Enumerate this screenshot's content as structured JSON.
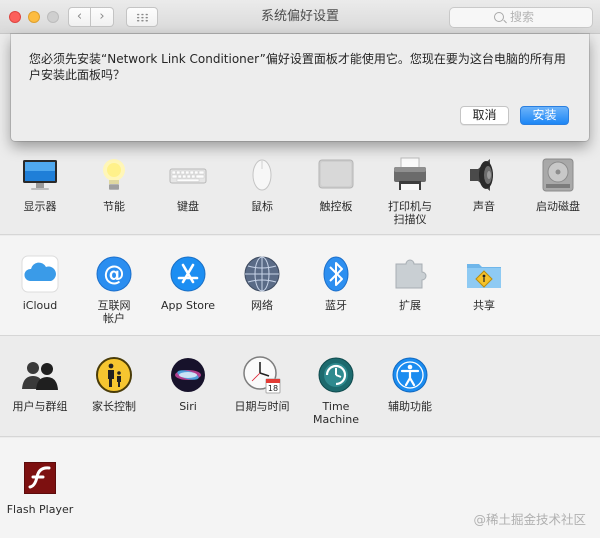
{
  "window": {
    "title": "系统偏好设置",
    "search_placeholder": "搜索",
    "back_glyph": "‹",
    "forward_glyph": "›"
  },
  "dialog": {
    "message": "您必须先安装“Network Link Conditioner”偏好设置面板才能使用它。您现在要为这台电脑的所有用户安装此面板吗？",
    "cancel_label": "取消",
    "install_label": "安装",
    "accent_color": "#1d86f5"
  },
  "rows": [
    {
      "items": [
        {
          "label": "显示器",
          "icon": "display-icon"
        },
        {
          "label": "节能",
          "icon": "lightbulb-icon"
        },
        {
          "label": "键盘",
          "icon": "keyboard-icon"
        },
        {
          "label": "鼠标",
          "icon": "mouse-icon"
        },
        {
          "label": "触控板",
          "icon": "trackpad-icon"
        },
        {
          "label": "打印机与\n扫描仪",
          "icon": "printer-icon"
        },
        {
          "label": "声音",
          "icon": "speaker-icon"
        },
        {
          "label": "启动磁盘",
          "icon": "disk-icon"
        }
      ]
    },
    {
      "items": [
        {
          "label": "iCloud",
          "icon": "icloud-icon"
        },
        {
          "label": "互联网\n帐户",
          "icon": "internet-accounts-icon"
        },
        {
          "label": "App Store",
          "icon": "app-store-icon"
        },
        {
          "label": "网络",
          "icon": "network-globe-icon"
        },
        {
          "label": "蓝牙",
          "icon": "bluetooth-icon"
        },
        {
          "label": "扩展",
          "icon": "puzzle-icon"
        },
        {
          "label": "共享",
          "icon": "sharing-folder-icon"
        }
      ]
    },
    {
      "items": [
        {
          "label": "用户与群组",
          "icon": "users-icon"
        },
        {
          "label": "家长控制",
          "icon": "parental-controls-icon"
        },
        {
          "label": "Siri",
          "icon": "siri-icon"
        },
        {
          "label": "日期与时间",
          "icon": "clock-calendar-icon"
        },
        {
          "label": "Time Machine",
          "icon": "time-machine-icon"
        },
        {
          "label": "辅助功能",
          "icon": "accessibility-icon"
        }
      ]
    },
    {
      "items": [
        {
          "label": "Flash Player",
          "icon": "flash-player-icon"
        }
      ]
    }
  ],
  "watermark": "@稀土掘金技术社区"
}
